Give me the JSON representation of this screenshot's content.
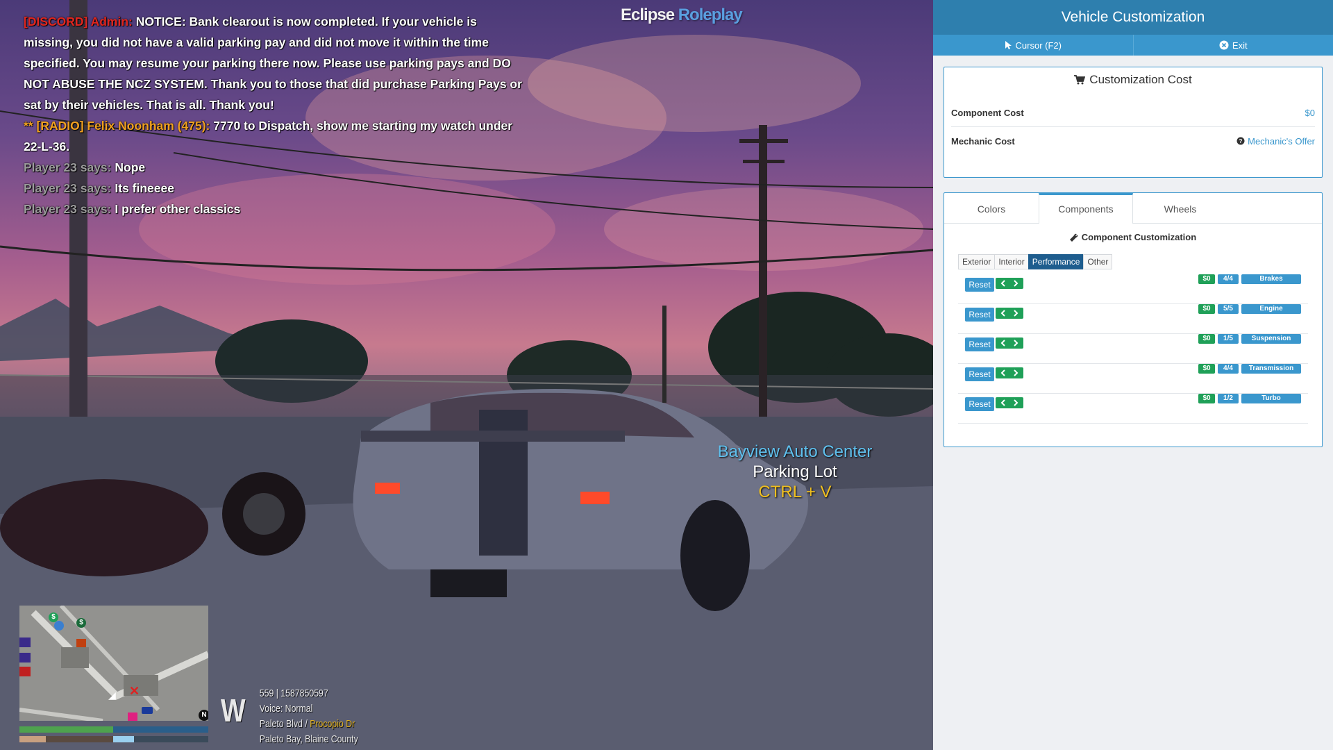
{
  "logo": {
    "part1": "Eclipse",
    "part2": "Roleplay"
  },
  "chat": {
    "admin": {
      "tag": "[DISCORD] Admin:",
      "text": "NOTICE: Bank clearout is now completed. If your vehicle is missing, you did not have a valid parking pay and did not move it within the time specified. You may resume your parking there now. Please use parking pays and DO NOT ABUSE THE NCZ SYSTEM. Thank you to those that did purchase Parking Pays or sat by their vehicles. That is all. Thank you!"
    },
    "radio": {
      "prefix": "** [RADIO] Felix Noonham (475):",
      "text": "7770 to Dispatch, show me starting my watch under 22-L-36."
    },
    "says": [
      {
        "speaker": "Player 23 says:",
        "text": "Nope"
      },
      {
        "speaker": "Player 23 says:",
        "text": "Its fineeee"
      },
      {
        "speaker": "Player 23 says:",
        "text": "I prefer other classics"
      }
    ]
  },
  "location_label": {
    "name": "Bayview Auto Center",
    "place": "Parking Lot",
    "hint": "CTRL + V"
  },
  "hud": {
    "compass": "W",
    "id_line": "559 | 1587850597",
    "voice": "Voice: Normal",
    "street": "Paleto Blvd",
    "separator": " / ",
    "cross_street": "Procopio Dr",
    "zone": "Paleto Bay, Blaine County",
    "north_marker": "N"
  },
  "panel": {
    "title": "Vehicle Customization",
    "cursor_label": "Cursor (F2)",
    "exit_label": "Exit",
    "cost": {
      "title": "Customization Cost",
      "component_label": "Component Cost",
      "component_value": "$0",
      "mechanic_label": "Mechanic Cost",
      "mechanic_value": "Mechanic's Offer"
    },
    "tabs": [
      "Colors",
      "Components",
      "Wheels"
    ],
    "active_tab": "Components",
    "section_title": "Component Customization",
    "subtabs": [
      "Exterior",
      "Interior",
      "Performance",
      "Other"
    ],
    "active_subtab": "Performance",
    "reset_label": "Reset",
    "components": [
      {
        "price": "$0",
        "level": "4/4",
        "name": "Brakes"
      },
      {
        "price": "$0",
        "level": "5/5",
        "name": "Engine"
      },
      {
        "price": "$0",
        "level": "1/5",
        "name": "Suspension"
      },
      {
        "price": "$0",
        "level": "4/4",
        "name": "Transmission"
      },
      {
        "price": "$0",
        "level": "1/2",
        "name": "Turbo"
      }
    ]
  },
  "colors": {
    "panel_header": "#2e7fae",
    "panel_nav": "#3a97cd",
    "accent_green": "#1fa058",
    "active_subtab": "#1e5d8e"
  }
}
